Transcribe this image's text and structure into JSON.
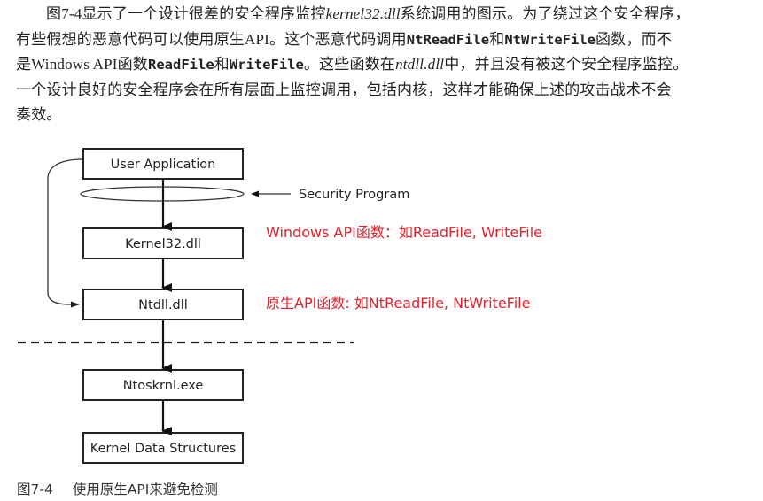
{
  "paragraph": {
    "line1": {
      "a": "图7-4显示了一个设计很差的安全程序监控",
      "b_italic": "kernel32.dll",
      "c": "系统调用的图示。为了绕过这个安全程序，"
    },
    "line2": {
      "a": "有些假想的恶意代码可以使用原生API。这个恶意代码调用",
      "b_mono": "NtReadFile",
      "c": "和",
      "d_mono": "NtWriteFile",
      "e": "函数，而不"
    },
    "line3": {
      "a": "是Windows API函数",
      "b_mono": "ReadFile",
      "c": "和",
      "d_mono": "WriteFile",
      "e": "。这些函数在",
      "f_italic": "ntdll.dll",
      "g": "中，并且没有被这个安全程序监控。"
    },
    "line4": "一个设计良好的安全程序会在所有层面上监控调用，包括内核，这样才能确保上述的攻击战术不会",
    "line5": "奏效。"
  },
  "diagram": {
    "boxes": [
      {
        "id": "user-application",
        "label": "User Application"
      },
      {
        "id": "kernel32",
        "label": "Kernel32.dll"
      },
      {
        "id": "ntdll",
        "label": "Ntdll.dll"
      },
      {
        "id": "ntoskrnl",
        "label": "Ntoskrnl.exe"
      },
      {
        "id": "kernel-data",
        "label": "Kernel Data Structures"
      }
    ],
    "security_label": "Security Program"
  },
  "annotations": {
    "color": "#e8202a",
    "windows_api": "Windows API函数：如ReadFile, WriteFile",
    "native_api": "原生API函数: 如NtReadFile, NtWriteFile"
  },
  "caption": {
    "number": "图7-4",
    "text": "使用原生API来避免检测"
  }
}
